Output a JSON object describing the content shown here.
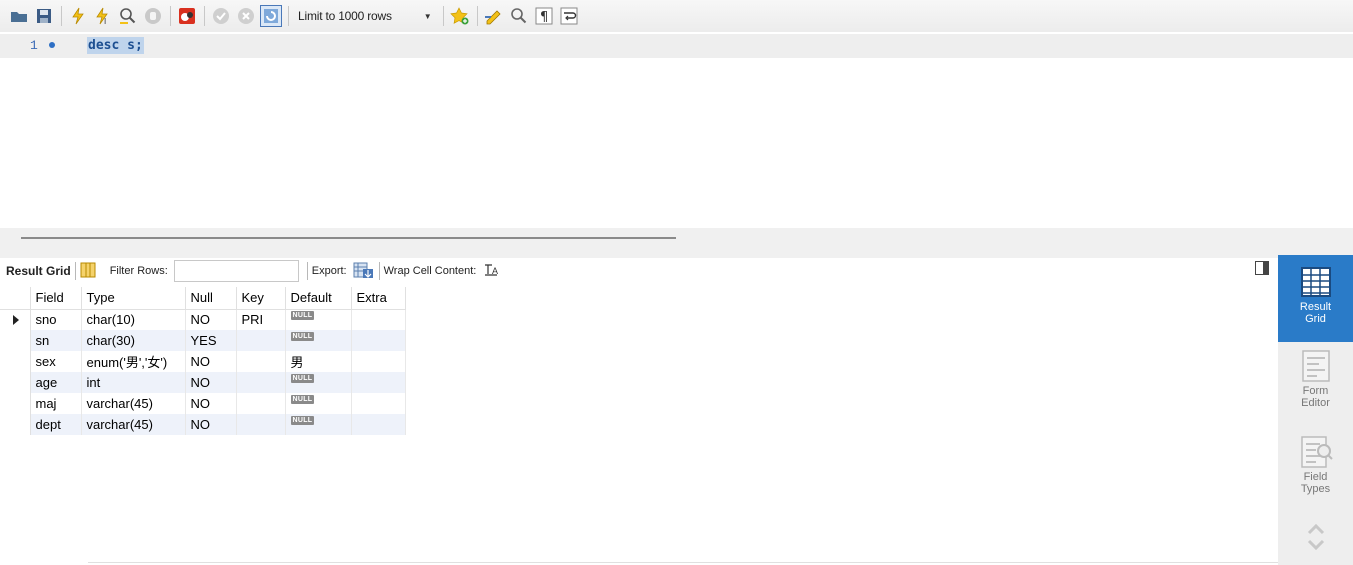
{
  "toolbar": {
    "limit_select": "Limit to 1000 rows",
    "icons": [
      "folder-open-icon",
      "save-icon",
      "execute-icon",
      "execute-current-icon",
      "explain-icon",
      "stop-icon",
      "toggle-error-stop-icon",
      "commit-icon",
      "rollback-icon",
      "autocommit-icon",
      "limit-dropdown",
      "bookmark-icon",
      "beautify-icon",
      "find-icon",
      "invisible-chars-icon",
      "wrap-icon"
    ]
  },
  "editor": {
    "line_number": "1",
    "code": "desc s;"
  },
  "result_toolbar": {
    "result_grid": "Result Grid",
    "filter_rows": "Filter Rows:",
    "filter_value": "",
    "export": "Export:",
    "wrap_cell": "Wrap Cell Content:"
  },
  "grid": {
    "headers": [
      "Field",
      "Type",
      "Null",
      "Key",
      "Default",
      "Extra"
    ],
    "rows": [
      {
        "field": "sno",
        "type": "char(10)",
        "null": "NO",
        "key": "PRI",
        "default": "NULL",
        "extra": ""
      },
      {
        "field": "sn",
        "type": "char(30)",
        "null": "YES",
        "key": "",
        "default": "NULL",
        "extra": ""
      },
      {
        "field": "sex",
        "type": "enum('男','女')",
        "null": "NO",
        "key": "",
        "default": "男",
        "extra": ""
      },
      {
        "field": "age",
        "type": "int",
        "null": "NO",
        "key": "",
        "default": "NULL",
        "extra": ""
      },
      {
        "field": "maj",
        "type": "varchar(45)",
        "null": "NO",
        "key": "",
        "default": "NULL",
        "extra": ""
      },
      {
        "field": "dept",
        "type": "varchar(45)",
        "null": "NO",
        "key": "",
        "default": "NULL",
        "extra": ""
      }
    ]
  },
  "side_panel": {
    "result_grid_l1": "Result",
    "result_grid_l2": "Grid",
    "form_editor_l1": "Form",
    "form_editor_l2": "Editor",
    "field_types_l1": "Field",
    "field_types_l2": "Types"
  }
}
